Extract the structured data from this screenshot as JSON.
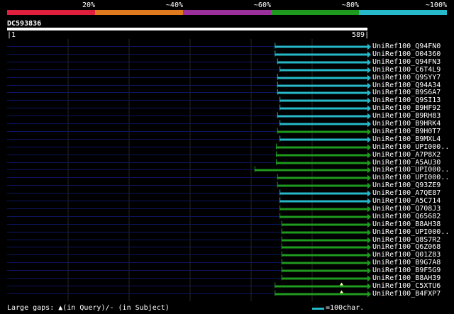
{
  "legend": {
    "colors": [
      "#e01f3c",
      "#e07a1f",
      "#9b2f9c",
      "#1e9a1e",
      "#26b9c9"
    ],
    "labels": [
      "20%",
      "~40%",
      "~60%",
      "~80%",
      "~100%"
    ]
  },
  "query": {
    "id": "DC593836",
    "start": "1",
    "end": "589",
    "length": 589
  },
  "colors": {
    "cyan": "#26b9c9",
    "green": "#1e9a1e",
    "track": "#0b1560",
    "grid": "#262626",
    "query": "#ffffff"
  },
  "hits": [
    {
      "label": "UniRef100_Q94FN0",
      "start": 438,
      "color": "cyan",
      "gap": false
    },
    {
      "label": "UniRef100_O04360",
      "start": 438,
      "color": "cyan",
      "gap": false
    },
    {
      "label": "UniRef100_Q94FN3",
      "start": 442,
      "color": "cyan",
      "gap": false
    },
    {
      "label": "UniRef100_C6T4L9",
      "start": 446,
      "color": "cyan",
      "gap": false
    },
    {
      "label": "UniRef100_Q9SYY7",
      "start": 442,
      "color": "cyan",
      "gap": false
    },
    {
      "label": "UniRef100_Q94A34",
      "start": 442,
      "color": "cyan",
      "gap": false
    },
    {
      "label": "UniRef100_B9S6A7",
      "start": 442,
      "color": "cyan",
      "gap": false
    },
    {
      "label": "UniRef100_Q9SI13",
      "start": 446,
      "color": "cyan",
      "gap": false
    },
    {
      "label": "UniRef100_B9HF92",
      "start": 446,
      "color": "cyan",
      "gap": false
    },
    {
      "label": "UniRef100_B9RH83",
      "start": 442,
      "color": "cyan",
      "gap": false
    },
    {
      "label": "UniRef100_B9HRK4",
      "start": 446,
      "color": "cyan",
      "gap": false
    },
    {
      "label": "UniRef100_B9H0T7",
      "start": 442,
      "color": "green",
      "gap": false
    },
    {
      "label": "UniRef100_B9MXL4",
      "start": 446,
      "color": "cyan",
      "gap": false
    },
    {
      "label": "UniRef100_UPI000..",
      "start": 440,
      "color": "green",
      "gap": false
    },
    {
      "label": "UniRef100_A7P8X2",
      "start": 440,
      "color": "green",
      "gap": false
    },
    {
      "label": "UniRef100_A5AU30",
      "start": 440,
      "color": "green",
      "gap": false
    },
    {
      "label": "UniRef100_UPI000..",
      "start": 405,
      "color": "green",
      "gap": false
    },
    {
      "label": "UniRef100_UPI000..",
      "start": 442,
      "color": "green",
      "gap": false
    },
    {
      "label": "UniRef100_Q93ZE9",
      "start": 442,
      "color": "green",
      "gap": false
    },
    {
      "label": "UniRef100_A7QE87",
      "start": 446,
      "color": "cyan",
      "gap": false
    },
    {
      "label": "UniRef100_A5C714",
      "start": 446,
      "color": "cyan",
      "gap": false
    },
    {
      "label": "UniRef100_Q708J3",
      "start": 446,
      "color": "green",
      "gap": false
    },
    {
      "label": "UniRef100_Q65682",
      "start": 446,
      "color": "green",
      "gap": false
    },
    {
      "label": "UniRef100_B8AH38",
      "start": 449,
      "color": "green",
      "gap": false
    },
    {
      "label": "UniRef100_UPI000..",
      "start": 449,
      "color": "green",
      "gap": false
    },
    {
      "label": "UniRef100_Q8S7R2",
      "start": 449,
      "color": "green",
      "gap": false
    },
    {
      "label": "UniRef100_Q6Z068",
      "start": 449,
      "color": "green",
      "gap": false
    },
    {
      "label": "UniRef100_Q01Z83",
      "start": 449,
      "color": "green",
      "gap": false
    },
    {
      "label": "UniRef100_B9G7A8",
      "start": 449,
      "color": "green",
      "gap": false
    },
    {
      "label": "UniRef100_B9F5G9",
      "start": 449,
      "color": "green",
      "gap": false
    },
    {
      "label": "UniRef100_B8AH39",
      "start": 449,
      "color": "green",
      "gap": false
    },
    {
      "label": "UniRef100_C5XTU6",
      "start": 438,
      "color": "green",
      "gap": true
    },
    {
      "label": "UniRef100_B4FXP7",
      "start": 438,
      "color": "green",
      "gap": true
    }
  ],
  "footer": {
    "gaps_text": "Large gaps: ▲(in Query)/- (in Subject)",
    "scale_text": "=100char."
  }
}
